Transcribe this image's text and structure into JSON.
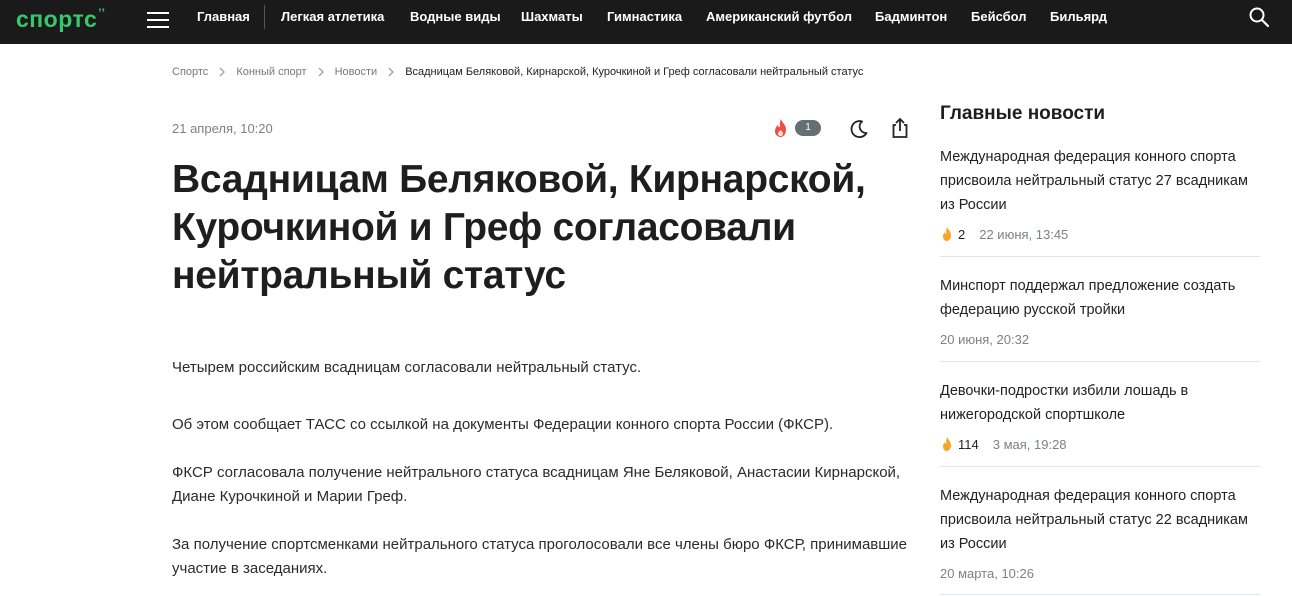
{
  "header": {
    "logo": "спортс",
    "logo_mark": "’’",
    "nav": [
      "Главная",
      "Легкая атлетика",
      "Водные виды",
      "Шахматы",
      "Гимнастика",
      "Американский футбол",
      "Бадминтон",
      "Бейсбол",
      "Бильярд"
    ]
  },
  "breadcrumb": [
    "Спортс",
    "Конный спорт",
    "Новости",
    "Всадницам Беляковой, Кирнарской, Курочкиной и Греф согласовали нейтральный статус"
  ],
  "article": {
    "date": "21 апреля, 10:20",
    "reactions_count": "1",
    "title": "Всадницам Беляковой, Кирнарской, Курочкиной и Греф согласовали нейтральный статус",
    "paragraphs": [
      "Четырем российским всадницам согласовали нейтральный статус.",
      "Об этом сообщает ТАСС со ссылкой на документы Федерации конного спорта России (ФКСР).",
      "ФКСР согласовала получение нейтрального статуса всадницам Яне Беляковой, Анастасии Кирнарской, Диане Курочкиной и Марии Греф.",
      "За получение спортсменками нейтрального статуса проголосовали все члены бюро ФКСР, принимавшие участие в заседаниях."
    ]
  },
  "sidebar": {
    "title": "Главные новости",
    "items": [
      {
        "headline": "Международная федерация конного спорта присвоила нейтральный статус 27 всадникам из России",
        "reactions": "2",
        "time": "22 июня, 13:45"
      },
      {
        "headline": "Минспорт поддержал предложение создать федерацию русской тройки",
        "reactions": "",
        "time": "20 июня, 20:32"
      },
      {
        "headline": "Девочки-подростки избили лошадь в нижегородской спортшколе",
        "reactions": "114",
        "time": "3 мая, 19:28"
      },
      {
        "headline": "Международная федерация конного спорта присвоила нейтральный статус 22 всадникам из России",
        "reactions": "",
        "time": "20 марта, 10:26"
      }
    ]
  },
  "colors": {
    "brand": "#37c86b",
    "topbar": "#1a1a1a",
    "fire": "#f04e3e",
    "fire_small": "#f5a623"
  }
}
